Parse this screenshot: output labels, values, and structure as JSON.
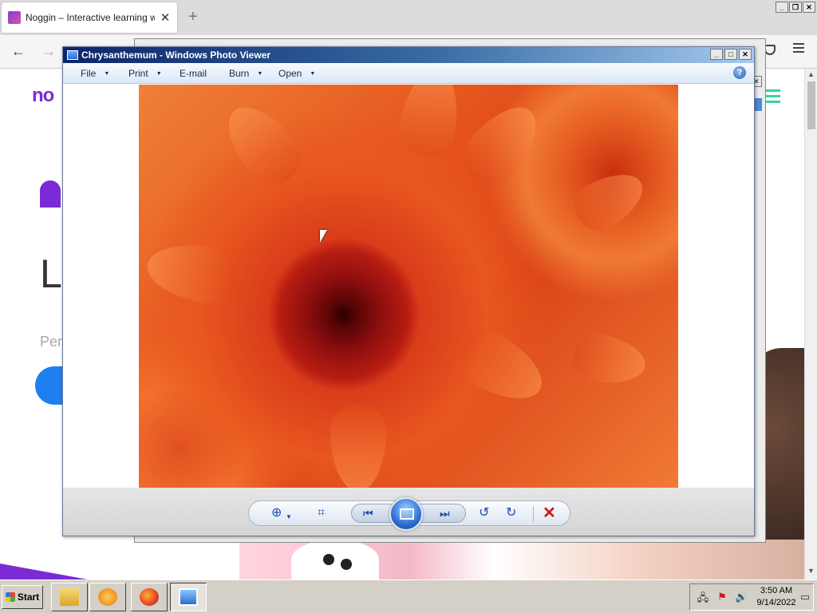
{
  "browser": {
    "tab_title": "Noggin – Interactive learning with",
    "tab_close": "✕",
    "new_tab": "+",
    "back": "←",
    "forward": "→"
  },
  "page": {
    "logo_peek": "no",
    "heading_peek": "L",
    "text_peek": "Per"
  },
  "viewer": {
    "title": "Chrysanthemum - Windows Photo Viewer",
    "menu": [
      {
        "label": "File"
      },
      {
        "label": "Print"
      },
      {
        "label": "E-mail"
      },
      {
        "label": "Burn"
      },
      {
        "label": "Open"
      }
    ],
    "help": "?",
    "controls": {
      "zoom": "⊕",
      "fit": "⌗",
      "previous": "⏮",
      "next": "⏭",
      "rotate_ccw": "↺",
      "rotate_cw": "↻",
      "delete": "✕"
    }
  },
  "taskbar": {
    "start_label": "Start",
    "clock_time": "3:50 AM",
    "clock_date": "9/14/2022"
  },
  "colors": {
    "photo_accent": "#e4511c",
    "titlebar": "#0a246a",
    "noggin_purple": "#7a2bd6"
  }
}
